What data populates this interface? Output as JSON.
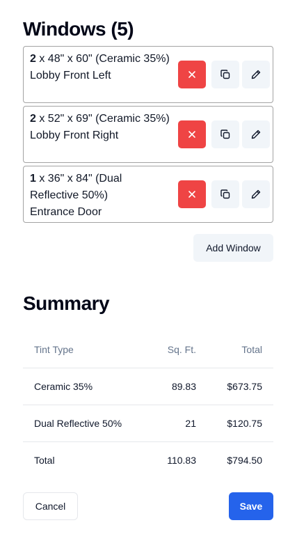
{
  "windows_section": {
    "title": "Windows (5)",
    "items": [
      {
        "qty": "2",
        "dims": " x 48\" x 60\" (Ceramic 35%)",
        "location": "Lobby Front Left"
      },
      {
        "qty": "2",
        "dims": " x 52\" x 69\" (Ceramic 35%)",
        "location": "Lobby Front Right"
      },
      {
        "qty": "1",
        "dims": " x 36\" x 84\" (Dual Reflective 50%)",
        "location": "Entrance Door"
      }
    ],
    "add_button": "Add Window"
  },
  "summary": {
    "title": "Summary",
    "columns": [
      "Tint Type",
      "Sq. Ft.",
      "Total"
    ],
    "rows": [
      {
        "type": "Ceramic 35%",
        "sqft": "89.83",
        "total": "$673.75"
      },
      {
        "type": "Dual Reflective 50%",
        "sqft": "21",
        "total": "$120.75"
      },
      {
        "type": "Total",
        "sqft": "110.83",
        "total": "$794.50"
      }
    ]
  },
  "footer": {
    "cancel": "Cancel",
    "save": "Save"
  },
  "icons": {
    "delete": "x-icon",
    "duplicate": "copy-icon",
    "edit": "pencil-icon"
  },
  "colors": {
    "primary": "#2563eb",
    "danger": "#ef4444",
    "secondary": "#f1f5f9"
  }
}
